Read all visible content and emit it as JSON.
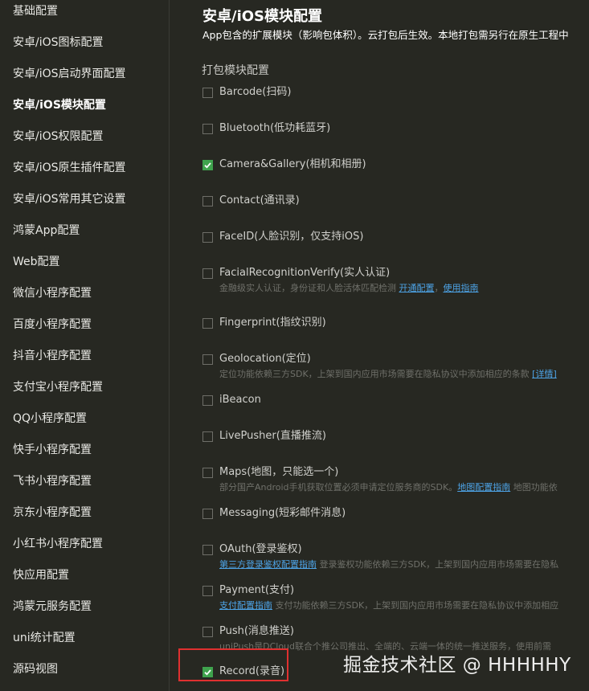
{
  "sidebar": {
    "items": [
      {
        "label": "基础配置"
      },
      {
        "label": "安卓/iOS图标配置"
      },
      {
        "label": "安卓/iOS启动界面配置"
      },
      {
        "label": "安卓/iOS模块配置",
        "active": true
      },
      {
        "label": "安卓/iOS权限配置"
      },
      {
        "label": "安卓/iOS原生插件配置"
      },
      {
        "label": "安卓/iOS常用其它设置"
      },
      {
        "label": "鸿蒙App配置"
      },
      {
        "label": "Web配置"
      },
      {
        "label": "微信小程序配置"
      },
      {
        "label": "百度小程序配置"
      },
      {
        "label": "抖音小程序配置"
      },
      {
        "label": "支付宝小程序配置"
      },
      {
        "label": "QQ小程序配置"
      },
      {
        "label": "快手小程序配置"
      },
      {
        "label": "飞书小程序配置"
      },
      {
        "label": "京东小程序配置"
      },
      {
        "label": "小红书小程序配置"
      },
      {
        "label": "快应用配置"
      },
      {
        "label": "鸿蒙元服务配置"
      },
      {
        "label": "uni统计配置"
      },
      {
        "label": "源码视图"
      }
    ]
  },
  "main": {
    "title": "安卓/iOS模块配置",
    "description": "App包含的扩展模块（影响包体积）。云打包后生效。本地打包需另行在原生工程中",
    "section_title": "打包模块配置",
    "modules": [
      {
        "label": "Barcode(扫码)",
        "checked": false
      },
      {
        "label": "Bluetooth(低功耗蓝牙)",
        "checked": false
      },
      {
        "label": "Camera&Gallery(相机和相册)",
        "checked": true
      },
      {
        "label": "Contact(通讯录)",
        "checked": false
      },
      {
        "label": "FaceID(人脸识别，仅支持iOS)",
        "checked": false
      },
      {
        "label": "FacialRecognitionVerify(实人认证)",
        "checked": false,
        "sub": {
          "text1": "金融级实人认证，身份证和人脸活体匹配检测 ",
          "link1": "开通配置",
          "text2": "，",
          "link2": "使用指南",
          "text3": ""
        }
      },
      {
        "label": "Fingerprint(指纹识别)",
        "checked": false
      },
      {
        "label": "Geolocation(定位)",
        "checked": false,
        "sub": {
          "text1": "定位功能依赖三方SDK，上架到国内应用市场需要在隐私协议中添加相应的条款 ",
          "link1": "[详情]",
          "text2": "",
          "link2": "",
          "text3": ""
        }
      },
      {
        "label": "iBeacon",
        "checked": false
      },
      {
        "label": "LivePusher(直播推流)",
        "checked": false
      },
      {
        "label": "Maps(地图，只能选一个)",
        "checked": false,
        "sub": {
          "text1": "部分国产Android手机获取位置必须申请定位服务商的SDK。",
          "link1": "地图配置指南",
          "text2": " 地图功能依",
          "link2": "",
          "text3": ""
        }
      },
      {
        "label": "Messaging(短彩邮件消息)",
        "checked": false
      },
      {
        "label": "OAuth(登录鉴权)",
        "checked": false,
        "sub": {
          "text1": "",
          "link1": "第三方登录鉴权配置指南",
          "text2": " 登录鉴权功能依赖三方SDK，上架到国内应用市场需要在隐私",
          "link2": "",
          "text3": ""
        }
      },
      {
        "label": "Payment(支付)",
        "checked": false,
        "sub": {
          "text1": "",
          "link1": "支付配置指南",
          "text2": " 支付功能依赖三方SDK，上架到国内应用市场需要在隐私协议中添加相应",
          "link2": "",
          "text3": ""
        }
      },
      {
        "label": "Push(消息推送)",
        "checked": false,
        "sub": {
          "text1": "uniPush是DCloud联合个推公司推出、全端的、云端一体的统一推送服务，使用前需",
          "link1": "",
          "text2": "",
          "link2": "",
          "text3": ""
        }
      },
      {
        "label": "Record(录音)",
        "checked": true
      }
    ]
  },
  "watermark": "掘金技术社区 @ HHHHHY",
  "colors": {
    "background": "#272822",
    "accent_check": "#3fa34d",
    "link": "#4da3e6",
    "highlight_box": "#e03030"
  }
}
